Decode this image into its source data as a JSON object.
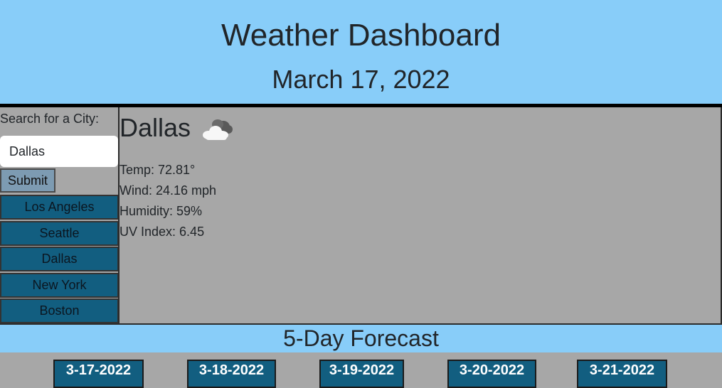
{
  "header": {
    "title": "Weather Dashboard",
    "date": "March 17, 2022"
  },
  "sidebar": {
    "search_label": "Search for a City:",
    "search_value": "Dallas",
    "submit_label": "Submit",
    "cities": [
      "Los Angeles",
      "Seattle",
      "Dallas",
      "New York",
      "Boston"
    ]
  },
  "current": {
    "city": "Dallas",
    "icon": "cloud-icon",
    "temp": "Temp: 72.81°",
    "wind": "Wind: 24.16 mph",
    "humidity": "Humidity: 59%",
    "uv": "UV Index: 6.45"
  },
  "forecast": {
    "title": "5-Day Forecast",
    "days": [
      "3-17-2022",
      "3-18-2022",
      "3-19-2022",
      "3-20-2022",
      "3-21-2022"
    ]
  },
  "colors": {
    "sky": "#88cdf9",
    "panel": "#a7a7a7",
    "city_button": "#125e80",
    "submit": "#7d9bb2"
  }
}
